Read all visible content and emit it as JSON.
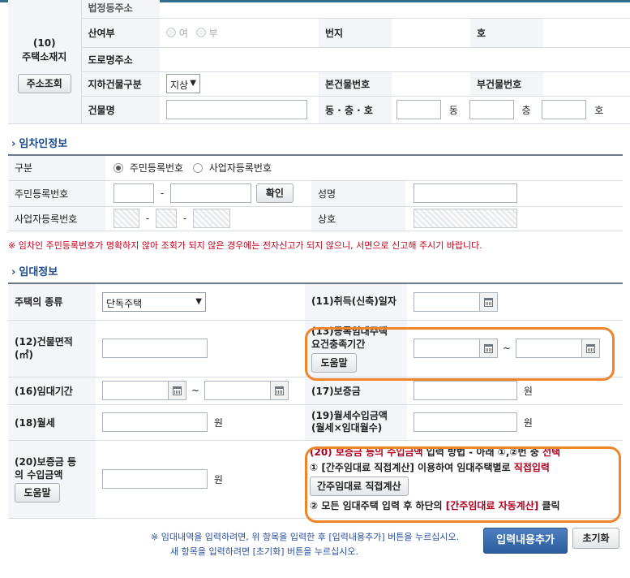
{
  "address": {
    "legal_dong_label": "법정동주소",
    "section_label": "(10)\n주택소재지",
    "search_button": "주소조회",
    "mountain_label": "산여부",
    "mountain_yes": "여",
    "mountain_no": "부",
    "lot_label": "번지",
    "ho_label": "호",
    "road_label": "도로명주소",
    "underground_label": "지하건물구분",
    "underground_value": "지상",
    "main_bldg_no_label": "본건물번호",
    "sub_bldg_no_label": "부건물번호",
    "bldg_name_label": "건물명",
    "dong_floor_ho_label": "동 · 층 · 호",
    "dong_unit": "동",
    "floor_unit": "층",
    "ho_unit": "호"
  },
  "lessee": {
    "title": "임차인정보",
    "type_label": "구분",
    "type_resident": "주민등록번호",
    "type_business": "사업자등록번호",
    "resident_no_label": "주민등록번호",
    "dash": "-",
    "confirm_button": "확인",
    "name_label": "성명",
    "business_no_label": "사업자등록번호",
    "trade_name_label": "상호",
    "warning": "※ 임차인 주민등록번호가 명확하지 않아 조회가 되지 않은 경우에는 전자신고가 되지 않으니, 서면으로 신고해 주시기 바랍니다."
  },
  "lease": {
    "title": "임대정보",
    "house_type_label": "주택의 종류",
    "house_type_value": "단독주택",
    "acquire_date_label": "(11)취득(신축)일자",
    "area_label": "(12)건물면적\n(㎡)",
    "req_period_label": "(13)등록임대주택\n요건충족기간",
    "help_button": "도움말",
    "tilde": "~",
    "period_label": "(16)임대기간",
    "deposit_label": "(17)보증금",
    "won": "원",
    "monthly_label": "(18)월세",
    "monthly_income_label": "(19)월세수입금액\n(월세×임대월수)",
    "deposit_income_label": "(20)보증금 등\n의 수입금액",
    "help_button2": "도움말"
  },
  "instructions": {
    "line1_a": "(20) 보증금 등의 수입금액",
    "line1_b": " 입력 방법 - 아래 ①,②번 중 ",
    "line1_c": "선택",
    "line2_a": "① [간주임대료 직접계산] 이용하여 임대주택별로 ",
    "line2_b": "직접입력",
    "calc_button": "간주임대료 직접계산",
    "line3_a": "② 모든 임대주택 입력 후 하단의 ",
    "line3_b": "[간주임대료 자동계산]",
    "line3_c": " 클릭"
  },
  "footer": {
    "note1": "※ 임대내역을 입력하려면, 위 항목을 입력한 후 [입력내용추가] 버튼을 누르십시오.",
    "note2": "새 항목을 입력하려면 [초기화] 버튼을 누르십시오.",
    "add_button": "입력내용추가",
    "reset_button": "초기화"
  },
  "colors": {
    "accent_orange": "#f0842b",
    "primary_blue": "#2c5d9d",
    "warning_red": "#c3001a"
  }
}
